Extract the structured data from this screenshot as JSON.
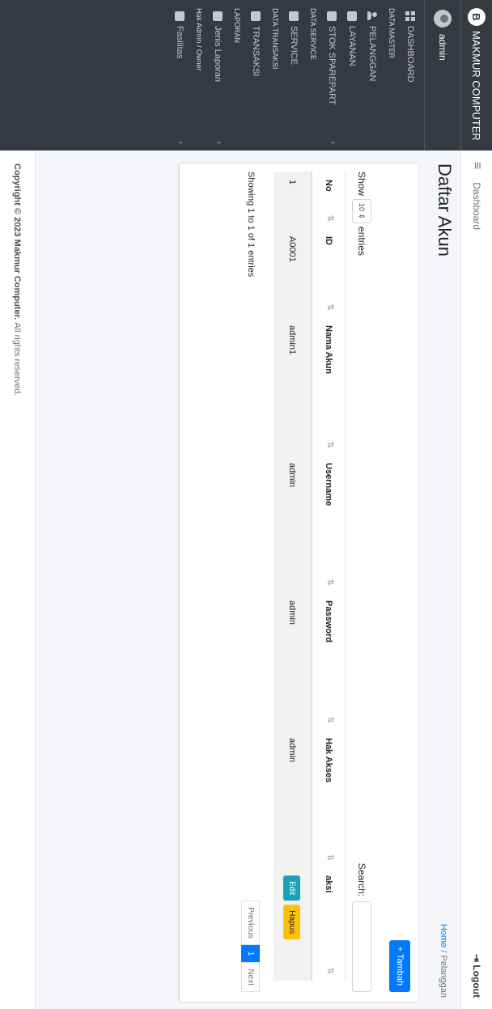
{
  "brand": {
    "logo": "B",
    "name": "MAKMUR COMPUTER"
  },
  "user": {
    "name": "admin"
  },
  "sidebar": {
    "items": [
      {
        "type": "item",
        "label": "DASHBOARD",
        "icon": "grid-icon"
      },
      {
        "type": "header",
        "label": "DATA MASTER"
      },
      {
        "type": "item",
        "label": "PELANGGAN",
        "icon": "users-icon"
      },
      {
        "type": "item",
        "label": "LAYANAN",
        "icon": "box-icon"
      },
      {
        "type": "item",
        "label": "STOK SPAREPART",
        "icon": "box-icon",
        "chevron": "‹"
      },
      {
        "type": "header",
        "label": "DATA SERVICE"
      },
      {
        "type": "item",
        "label": "SERVICE",
        "icon": "box-icon"
      },
      {
        "type": "header",
        "label": "DATA TRANSAKSI"
      },
      {
        "type": "item",
        "label": "TRANSAKSI",
        "icon": "box-icon"
      },
      {
        "type": "header",
        "label": "LAPORAN"
      },
      {
        "type": "item",
        "label": "Jenis Laporan",
        "icon": "box-icon",
        "chevron": "‹"
      },
      {
        "type": "header",
        "label": "Hak Admin / Owner"
      },
      {
        "type": "item",
        "label": "Fasilitas",
        "icon": "box-icon",
        "chevron": "‹"
      }
    ]
  },
  "header": {
    "menu_icon": "≡",
    "link": "Dashboard",
    "logout": "Logout"
  },
  "page": {
    "title": "Daftar Akun",
    "breadcrumb_home": "Home",
    "breadcrumb_sep": "/",
    "breadcrumb_current": "Pelanggan"
  },
  "card": {
    "add_label": "+ Tambah",
    "show_label": "Show",
    "entries_value": "10",
    "entries_label": "entries",
    "search_label": "Search:",
    "columns": [
      "No",
      "ID",
      "Nama Akun",
      "Username",
      "Password",
      "Hak Akses",
      "aksi"
    ],
    "rows": [
      {
        "no": "1",
        "id": "A0001",
        "nama": "admin1",
        "username": "admin",
        "password": "admin",
        "hak": "admin",
        "edit": "Edit",
        "hapus": "Hapus"
      }
    ],
    "info": "Showing 1 to 1 of 1 entries",
    "prev": "Previous",
    "page": "1",
    "next": "Next"
  },
  "footer": {
    "copyright": "Copyright © 2023 Makmur Computer.",
    "rights": "All rights reserved."
  }
}
